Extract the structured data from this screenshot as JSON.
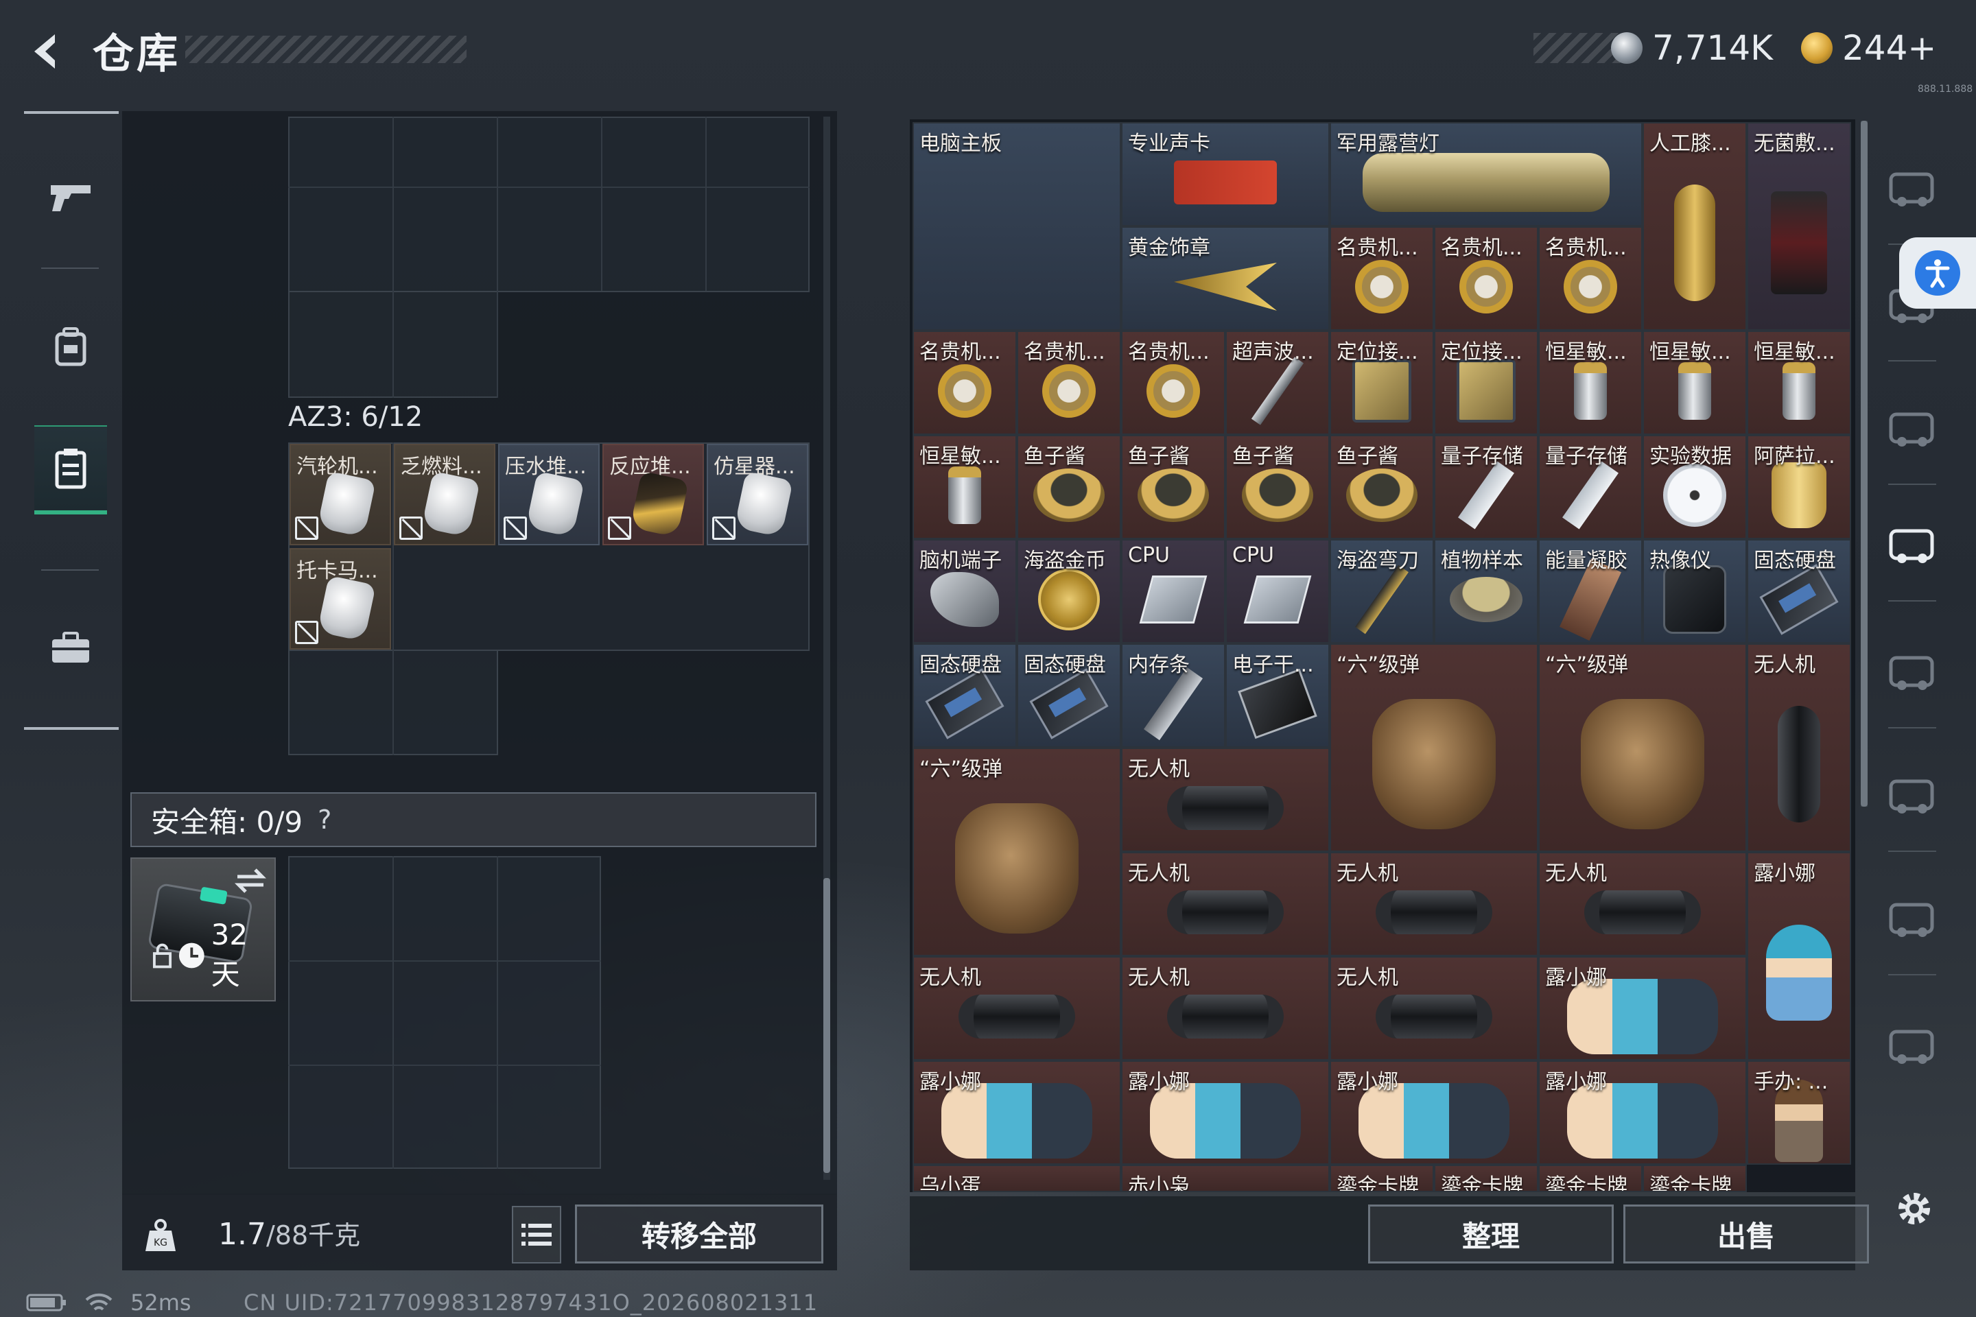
{
  "header": {
    "title": "仓库",
    "currency1": "7,714K",
    "currency2": "244+",
    "version": "888.11.888",
    "icons": [
      "back-arrow-icon",
      "silver-coin-icon",
      "gold-coin-icon"
    ]
  },
  "left_nav": [
    {
      "name": "weapon",
      "icon": "pistol-icon"
    },
    {
      "name": "armor",
      "icon": "backpack-icon"
    },
    {
      "name": "container",
      "icon": "clipboard-icon",
      "active": true
    },
    {
      "name": "case",
      "icon": "briefcase-icon"
    }
  ],
  "backpack": {
    "label": "AZ3: 6/12",
    "items": [
      {
        "name": "汽轮机...",
        "style": "brown"
      },
      {
        "name": "乏燃料...",
        "style": "brown"
      },
      {
        "name": "压水堆...",
        "style": "blue"
      },
      {
        "name": "反应堆...",
        "style": "red"
      },
      {
        "name": "仿星器...",
        "style": "blue"
      },
      {
        "name": "托卡马...",
        "style": "brown"
      }
    ]
  },
  "safe_box": {
    "label": "安全箱: 0/9",
    "help": "?",
    "days": "32天"
  },
  "bottom_left": {
    "weight": "1.7",
    "weight_max": "/88千克",
    "transfer": "转移全部"
  },
  "status": {
    "ping": "52ms",
    "uid": "CN UID:7217709983128797431O_202608021311"
  },
  "storage": {
    "items": [
      {
        "name": "电脑主板",
        "color": "blue",
        "icon": "motherboard"
      },
      {
        "name": "专业声卡",
        "color": "blue",
        "icon": "gpu"
      },
      {
        "name": "军用露营灯",
        "color": "blue",
        "icon": "lantern"
      },
      {
        "name": "人工膝...",
        "color": "red",
        "icon": "knee"
      },
      {
        "name": "无菌敷...",
        "color": "purple",
        "icon": "pack"
      },
      {
        "name": "黄金饰章",
        "color": "blue",
        "icon": "badge"
      },
      {
        "name": "名贵机...",
        "color": "red",
        "icon": "watch"
      },
      {
        "name": "名贵机...",
        "color": "red",
        "icon": "watch"
      },
      {
        "name": "名贵机...",
        "color": "red",
        "icon": "watch"
      },
      {
        "name": "名贵机...",
        "color": "red",
        "icon": "watch"
      },
      {
        "name": "名贵机...",
        "color": "red",
        "icon": "watch"
      },
      {
        "name": "名贵机...",
        "color": "red",
        "icon": "watch"
      },
      {
        "name": "超声波...",
        "color": "red",
        "icon": "pen"
      },
      {
        "name": "定位接...",
        "color": "red",
        "icon": "gps"
      },
      {
        "name": "定位接...",
        "color": "red",
        "icon": "gps"
      },
      {
        "name": "恒星敏...",
        "color": "red",
        "icon": "cyl"
      },
      {
        "name": "恒星敏...",
        "color": "red",
        "icon": "cyl"
      },
      {
        "name": "恒星敏...",
        "color": "red",
        "icon": "cyl"
      },
      {
        "name": "恒星敏...",
        "color": "red",
        "icon": "cyl"
      },
      {
        "name": "鱼子酱",
        "color": "red",
        "icon": "caviar"
      },
      {
        "name": "鱼子酱",
        "color": "red",
        "icon": "caviar"
      },
      {
        "name": "鱼子酱",
        "color": "red",
        "icon": "caviar"
      },
      {
        "name": "鱼子酱",
        "color": "red",
        "icon": "caviar"
      },
      {
        "name": "量子存储",
        "color": "red",
        "icon": "usb"
      },
      {
        "name": "量子存储",
        "color": "red",
        "icon": "usb"
      },
      {
        "name": "实验数据",
        "color": "red",
        "icon": "disc"
      },
      {
        "name": "阿萨拉...",
        "color": "red",
        "icon": "jar"
      },
      {
        "name": "脑机端子",
        "color": "purple",
        "icon": "claw"
      },
      {
        "name": "海盗金币",
        "color": "purple",
        "icon": "coin"
      },
      {
        "name": "CPU",
        "color": "purple",
        "icon": "cpu"
      },
      {
        "name": "CPU",
        "color": "purple",
        "icon": "cpu"
      },
      {
        "name": "海盗弯刀",
        "color": "blue",
        "icon": "knife"
      },
      {
        "name": "植物样本",
        "color": "blue",
        "icon": "sample"
      },
      {
        "name": "能量凝胶",
        "color": "blue",
        "icon": "gel"
      },
      {
        "name": "热像仪",
        "color": "blue",
        "icon": "thermal"
      },
      {
        "name": "固态硬盘",
        "color": "blue",
        "icon": "ssd"
      },
      {
        "name": "固态硬盘",
        "color": "blue",
        "icon": "ssd"
      },
      {
        "name": "固态硬盘",
        "color": "blue",
        "icon": "ssd"
      },
      {
        "name": "内存条",
        "color": "blue",
        "icon": "ram"
      },
      {
        "name": "电子干...",
        "color": "blue",
        "icon": "pcb"
      },
      {
        "name": "“六”级弹",
        "color": "red",
        "icon": "glove"
      },
      {
        "name": "“六”级弹",
        "color": "red",
        "icon": "glove"
      },
      {
        "name": "无人机",
        "color": "red",
        "icon": "drone-v"
      },
      {
        "name": "“六”级弹",
        "color": "red",
        "icon": "glove"
      },
      {
        "name": "无人机",
        "color": "red",
        "icon": "drone"
      },
      {
        "name": "无人机",
        "color": "red",
        "icon": "drone"
      },
      {
        "name": "无人机",
        "color": "red",
        "icon": "drone"
      },
      {
        "name": "无人机",
        "color": "red",
        "icon": "drone"
      },
      {
        "name": "露小娜",
        "color": "red",
        "icon": "doll"
      },
      {
        "name": "无人机",
        "color": "red",
        "icon": "drone"
      },
      {
        "name": "无人机",
        "color": "red",
        "icon": "drone"
      },
      {
        "name": "无人机",
        "color": "red",
        "icon": "drone"
      },
      {
        "name": "露小娜",
        "color": "red",
        "icon": "doll2"
      },
      {
        "name": "露小娜",
        "color": "red",
        "icon": "doll2"
      },
      {
        "name": "露小娜",
        "color": "red",
        "icon": "doll2"
      },
      {
        "name": "露小娜",
        "color": "red",
        "icon": "doll2"
      },
      {
        "name": "露小娜",
        "color": "red",
        "icon": "doll2"
      },
      {
        "name": "手办: ...",
        "color": "red",
        "icon": "figure"
      },
      {
        "name": "乌小蛋",
        "color": "red",
        "icon": "none"
      },
      {
        "name": "赤小枭",
        "color": "red",
        "icon": "none"
      },
      {
        "name": "鎏金卡牌",
        "color": "red",
        "icon": "none"
      },
      {
        "name": "鎏金卡牌",
        "color": "red",
        "icon": "none"
      },
      {
        "name": "鎏金卡牌",
        "color": "red",
        "icon": "none"
      },
      {
        "name": "鎏金卡牌",
        "color": "red",
        "icon": "none"
      }
    ]
  },
  "bottom_right": {
    "sort": "整理",
    "sell": "出售"
  },
  "right_sidebar": [
    {
      "name": "gate-icon"
    },
    {
      "name": "v-vehicle-icon"
    },
    {
      "name": "v-vehicle-icon"
    },
    {
      "name": "gti-vehicle-icon"
    },
    {
      "name": "v-vehicle-icon"
    },
    {
      "name": "iv-vehicle-icon"
    },
    {
      "name": "iv-vehicle-icon"
    },
    {
      "name": "gti-vehicle-icon"
    }
  ]
}
